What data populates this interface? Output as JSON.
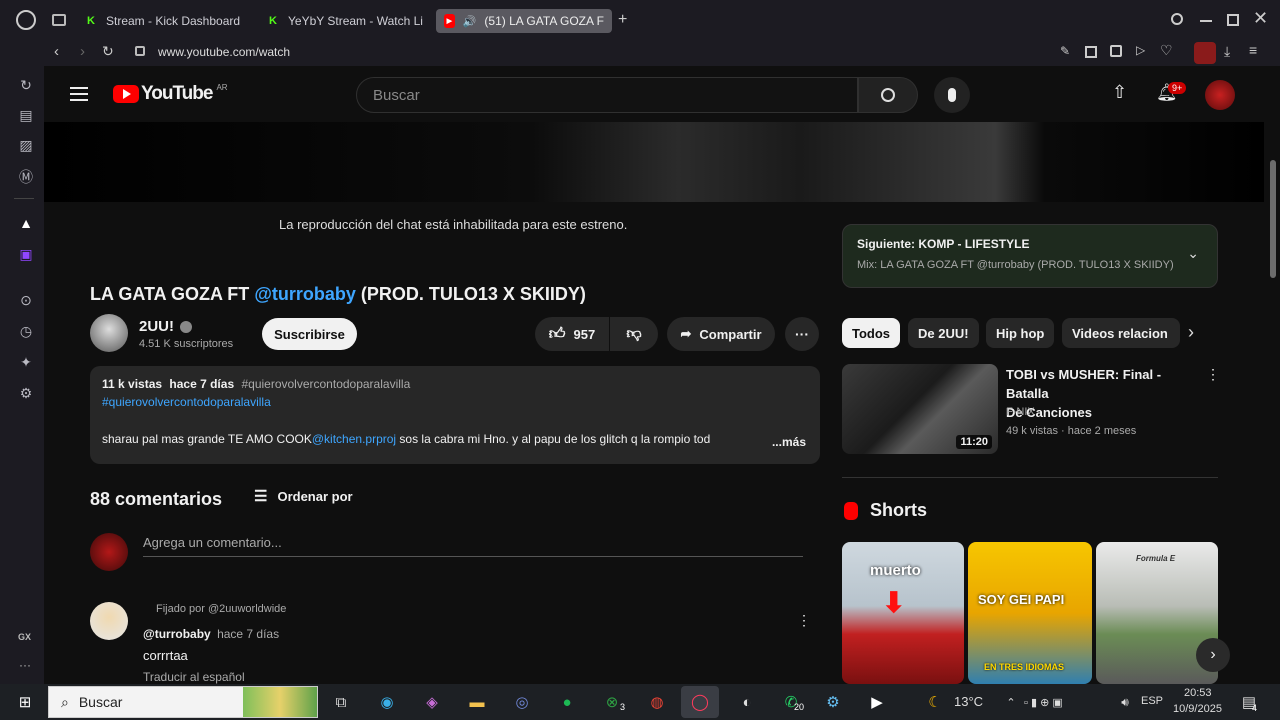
{
  "browser": {
    "tabs": [
      {
        "label": "Stream - Kick Dashboard",
        "icon": "K"
      },
      {
        "label": "YeYbY Stream - Watch Li",
        "icon": "K"
      },
      {
        "label": "(51) LA GATA GOZA F",
        "icon": "▶"
      }
    ],
    "new_tab": "+",
    "url": "www.youtube.com/watch"
  },
  "youtube": {
    "logo_text": "YouTube",
    "region": "AR",
    "search_placeholder": "Buscar",
    "notif_badge": "9+"
  },
  "chat_disabled": "La reproducción del chat está inhabilitada para este estreno.",
  "video": {
    "title_prefix": "LA GATA GOZA FT ",
    "title_mention": "@turrobaby",
    "title_suffix": " (PROD. TULO13 X SKIIDY)",
    "channel": "2UU!",
    "subscribers": "4.51 K suscriptores",
    "subscribe": "Suscribirse",
    "likes": "957",
    "share": "Compartir",
    "more": "···"
  },
  "description": {
    "views": "11 k vistas",
    "time": "hace 7 días",
    "hashtag1": "#quierovolvercontodoparalavilla",
    "hashtag2": "#quierovolvercontodoparalavilla",
    "text1": "sharau pal mas grande TE AMO COOK",
    "mention": "@kitchen.prproj",
    "text2": " sos la cabra mi Hno. y al papu de los glitch q la rompio tod",
    "more": "...más"
  },
  "comments": {
    "count": "88 comentarios",
    "sort": "Ordenar por",
    "placeholder": "Agrega un comentario...",
    "pinned_by": "Fijado por @2uuworldwide",
    "author": "@turrobaby",
    "time": "hace 7 días",
    "text": "corrrtaa",
    "translate": "Traducir al español"
  },
  "next": {
    "label": "Siguiente: KOMP - LIFESTYLE",
    "sub": "Mix: LA GATA GOZA FT @turrobaby (PROD. TULO13 X SKIIDY)"
  },
  "chips": [
    "Todos",
    "De 2UU!",
    "Hip hop",
    "Videos relacion"
  ],
  "recommended": {
    "title_line1": "TOBI vs MUSHER: Final - Batalla",
    "title_line2": "De Canciones",
    "channel": "F-NIX",
    "meta": "49 k vistas · hace 2 meses",
    "duration": "11:20"
  },
  "shorts": {
    "header": "Shorts",
    "items": [
      {
        "overlay": "muerto"
      },
      {
        "overlay": "SOY GEI PAPI",
        "caption": "EN TRES IDIOMAS"
      },
      {
        "overlay": "Formula E"
      }
    ]
  },
  "taskbar": {
    "search": "Buscar",
    "weather": "13°C",
    "lang": "ESP",
    "time": "20:53",
    "date": "10/9/2025",
    "badge_xbox": "3",
    "badge_whatsapp": "20",
    "badge_notif": "4"
  },
  "colors": {
    "accent_red": "#ff0000",
    "link_blue": "#3ea6ff",
    "kick_green": "#53fc18"
  }
}
